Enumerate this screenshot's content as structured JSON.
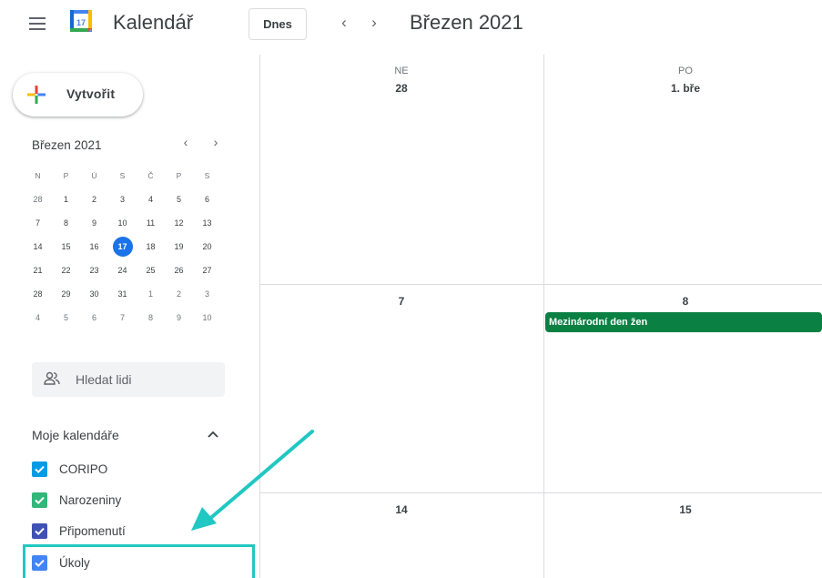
{
  "header": {
    "app_title": "Kalendář",
    "logo_day": "17",
    "today_label": "Dnes",
    "prev_icon": "chevron-left-icon",
    "next_icon": "chevron-right-icon",
    "prev_glyph": "‹",
    "next_glyph": "›",
    "period_title": "Březen 2021"
  },
  "sidebar": {
    "create_label": "Vytvořit",
    "mini_calendar": {
      "title": "Březen 2021",
      "prev_glyph": "‹",
      "next_glyph": "›",
      "weekday_headers": [
        "N",
        "P",
        "Ú",
        "S",
        "Č",
        "P",
        "S"
      ],
      "weeks": [
        [
          "28",
          "1",
          "2",
          "3",
          "4",
          "5",
          "6"
        ],
        [
          "7",
          "8",
          "9",
          "10",
          "11",
          "12",
          "13"
        ],
        [
          "14",
          "15",
          "16",
          "17",
          "18",
          "19",
          "20"
        ],
        [
          "21",
          "22",
          "23",
          "24",
          "25",
          "26",
          "27"
        ],
        [
          "28",
          "29",
          "30",
          "31",
          "1",
          "2",
          "3"
        ],
        [
          "4",
          "5",
          "6",
          "7",
          "8",
          "9",
          "10"
        ]
      ],
      "today": "17"
    },
    "people_search_placeholder": "Hledat lidi",
    "my_calendars": {
      "title": "Moje kalendáře",
      "items": [
        {
          "label": "CORIPO",
          "color": "#039be5",
          "checked": true
        },
        {
          "label": "Narozeniny",
          "color": "#33b679",
          "checked": true
        },
        {
          "label": "Připomenutí",
          "color": "#3f51b5",
          "checked": true
        },
        {
          "label": "Úkoly",
          "color": "#4285f4",
          "checked": true
        }
      ]
    }
  },
  "grid": {
    "columns": [
      {
        "dow": "NE",
        "date": "28"
      },
      {
        "dow": "PO",
        "date": "1. bře"
      }
    ],
    "rows": [
      [
        "7",
        "8"
      ],
      [
        "14",
        "15"
      ]
    ],
    "event": {
      "title": "Mezinárodní den žen",
      "color": "#0b8043"
    }
  },
  "colors": {
    "accent": "#1a73e8",
    "highlight": "#21c7c2"
  }
}
